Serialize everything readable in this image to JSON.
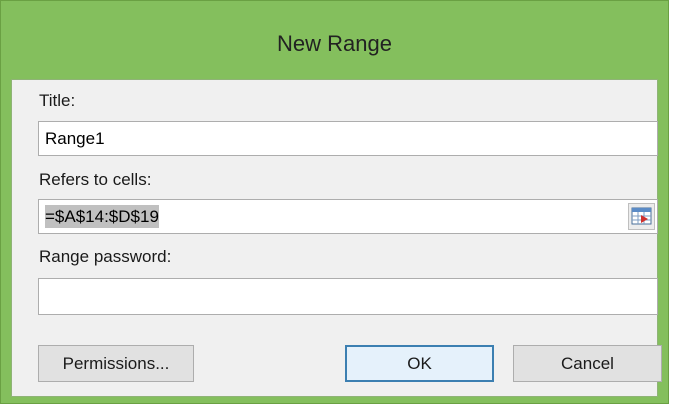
{
  "dialog": {
    "title": "New Range",
    "title_label_text": "Title:",
    "title_value": "Range1",
    "refers_label_text": "Refers to cells:",
    "refers_value": "=$A$14:$D$19",
    "password_label_text": "Range password:",
    "password_value": ""
  },
  "buttons": {
    "permissions": "Permissions...",
    "ok": "OK",
    "cancel": "Cancel"
  },
  "icons": {
    "collapse_dialog": "range-select-icon"
  },
  "colors": {
    "frame": "#84bf5d",
    "client": "#f0f0f0",
    "default_button_border": "#3c7fb1"
  }
}
